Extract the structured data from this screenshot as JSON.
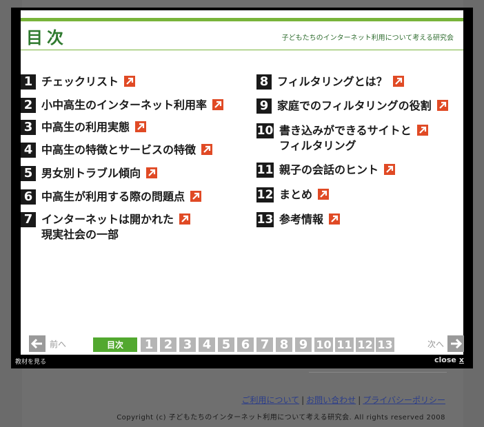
{
  "header": {
    "title": "目次",
    "organization": "子どもたちのインターネット利用について考える研究会"
  },
  "toc_left": [
    {
      "num": "1",
      "label": "チェックリスト"
    },
    {
      "num": "2",
      "label": "小中高生のインターネット利用率"
    },
    {
      "num": "3",
      "label": "中高生の利用実態"
    },
    {
      "num": "4",
      "label": "中高生の特徴とサービスの特徴"
    },
    {
      "num": "5",
      "label": "男女別トラブル傾向"
    },
    {
      "num": "6",
      "label": "中高生が利用する際の問題点"
    },
    {
      "num": "7",
      "label": "インターネットは開かれた",
      "label2": "現実社会の一部"
    }
  ],
  "toc_right": [
    {
      "num": "8",
      "label": "フィルタリングとは？"
    },
    {
      "num": "9",
      "label": "家庭でのフィルタリングの役割"
    },
    {
      "num": "10",
      "label": "書き込みができるサイトと",
      "label2": "フィルタリング"
    },
    {
      "num": "11",
      "label": "親子の会話のヒント"
    },
    {
      "num": "12",
      "label": "まとめ"
    },
    {
      "num": "13",
      "label": "参考情報"
    }
  ],
  "pager": {
    "prev_label": "前へ",
    "next_label": "次へ",
    "toc_label": "目次",
    "pages": [
      "1",
      "2",
      "3",
      "4",
      "5",
      "6",
      "7",
      "8",
      "9",
      "10",
      "11",
      "12",
      "13"
    ]
  },
  "modal_footer": {
    "left_text": "教材を見る",
    "close_text": "close",
    "close_x": "x"
  },
  "background": {
    "links": [
      "ご利用について",
      "お問い合わせ",
      "プライバシーポリシー"
    ],
    "separator": "|",
    "copyright": "Copyright (c) 子どもたちのインターネット利用について考える研究会. All rights reserved 2008"
  },
  "colors": {
    "accent_green": "#78b43a",
    "arrow_orange": "#e04a25",
    "toc_active": "#52a82f"
  }
}
